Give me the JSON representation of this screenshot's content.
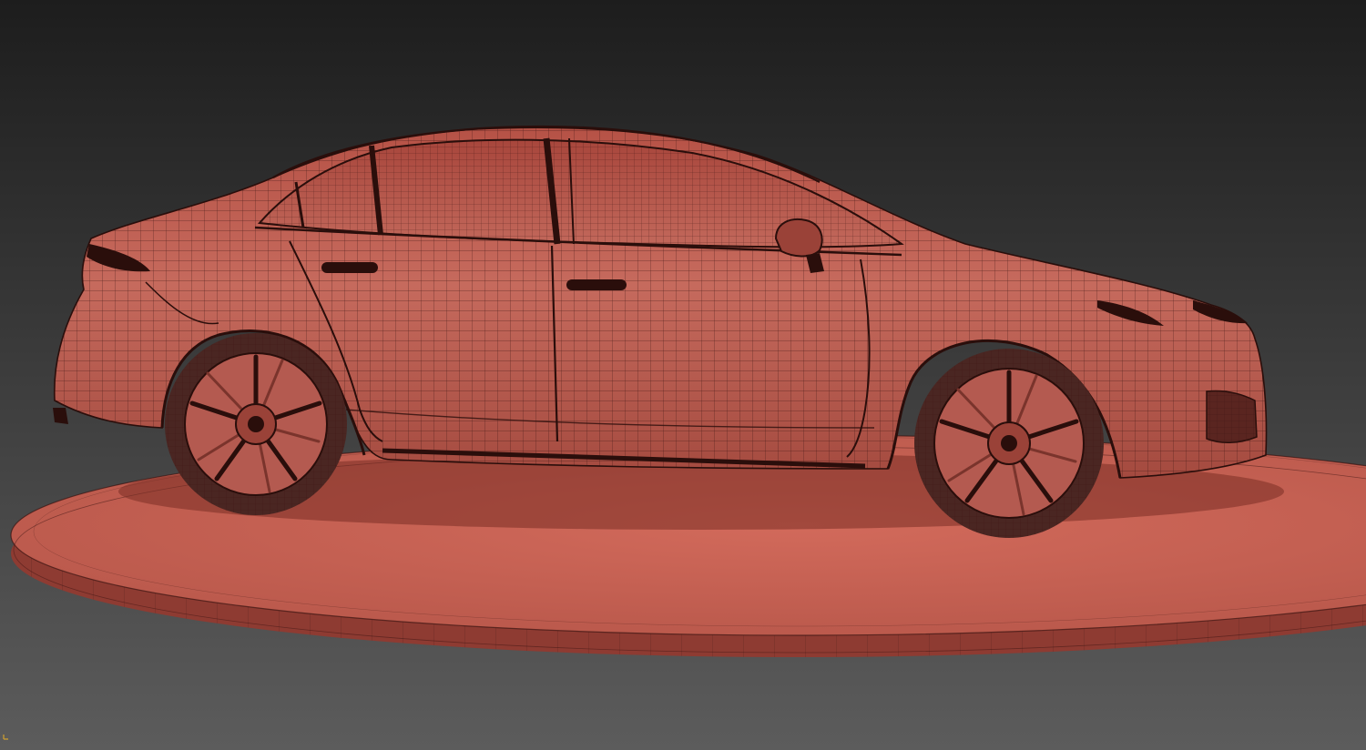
{
  "scene": {
    "subject": "sedan-wireframe-model",
    "platform": "round-turntable",
    "background": {
      "top": "#1d1d1d",
      "bottom": "#5c5c5c"
    },
    "mesh_color": "#c95c4f",
    "mesh_shadow": "#8a3a31",
    "wire_color": "#3a1411",
    "tire_color": "#4a2622",
    "rim_color": "#b45a50"
  },
  "gizmo": {
    "icon": "axis-gizmo-icon",
    "color": "#d0a030"
  }
}
